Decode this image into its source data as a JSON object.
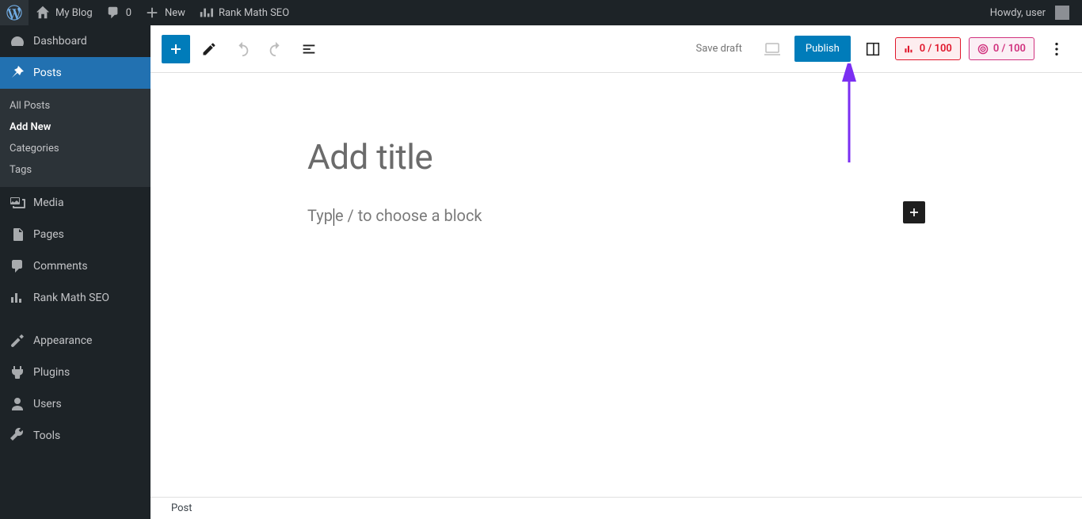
{
  "adminbar": {
    "site_name": "My Blog",
    "comments_count": "0",
    "new_label": "New",
    "seo_label": "Rank Math SEO",
    "howdy": "Howdy, user"
  },
  "sidebar": {
    "dashboard": "Dashboard",
    "posts": "Posts",
    "posts_sub": {
      "all": "All Posts",
      "add_new": "Add New",
      "categories": "Categories",
      "tags": "Tags"
    },
    "media": "Media",
    "pages": "Pages",
    "comments": "Comments",
    "rankmath": "Rank Math SEO",
    "appearance": "Appearance",
    "plugins": "Plugins",
    "users": "Users",
    "tools": "Tools"
  },
  "editor": {
    "save_draft": "Save draft",
    "publish": "Publish",
    "score1": "0 / 100",
    "score2": "0 / 100",
    "title_placeholder": "Add title",
    "body_prefix": "Typ",
    "body_suffix": "e / to choose a block",
    "breadcrumb": "Post"
  }
}
